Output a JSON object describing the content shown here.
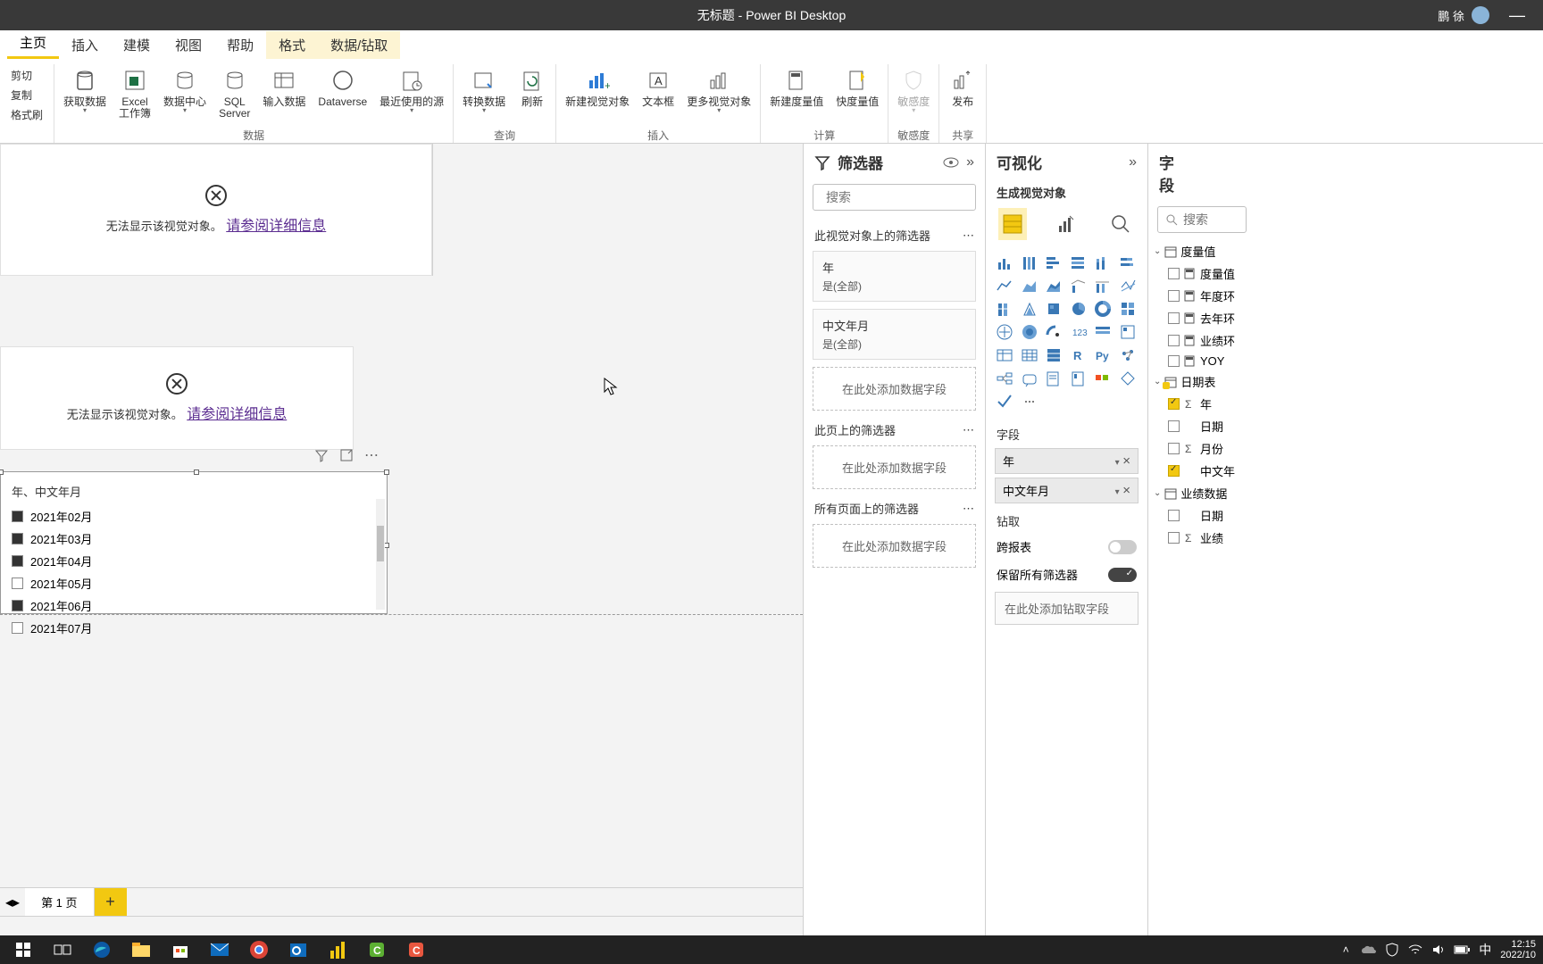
{
  "titlebar": {
    "title": "无标题 - Power BI Desktop",
    "user": "鹏 徐"
  },
  "menu": {
    "tabs": [
      "主页",
      "插入",
      "建模",
      "视图",
      "帮助",
      "格式",
      "数据/钻取"
    ],
    "active_index": 0,
    "highlight_from": 5
  },
  "ribbon": {
    "clipboard": {
      "cut": "剪切",
      "copy": "复制",
      "paint": "格式刷"
    },
    "data": {
      "label": "数据",
      "items": [
        "获取数据",
        "Excel\n工作簿",
        "数据中心",
        "SQL\nServer",
        "输入数据",
        "Dataverse",
        "最近使用的源"
      ]
    },
    "query": {
      "label": "查询",
      "items": [
        "转换数据",
        "刷新"
      ]
    },
    "insert": {
      "label": "插入",
      "items": [
        "新建视觉对象",
        "文本框",
        "更多视觉对象"
      ]
    },
    "calc": {
      "label": "计算",
      "items": [
        "新建度量值",
        "快度量值"
      ]
    },
    "sens": {
      "label": "敏感度",
      "items": [
        "敏感度"
      ]
    },
    "share": {
      "label": "共享",
      "items": [
        "发布"
      ]
    }
  },
  "canvas": {
    "visual_error": "无法显示该视觉对象。",
    "visual_link": "请参阅详细信息",
    "slicer_title": "年、中文年月",
    "slicer_items": [
      {
        "label": "2021年02月",
        "checked": true
      },
      {
        "label": "2021年03月",
        "checked": true
      },
      {
        "label": "2021年04月",
        "checked": true
      },
      {
        "label": "2021年05月",
        "checked": false
      },
      {
        "label": "2021年06月",
        "checked": true
      },
      {
        "label": "2021年07月",
        "checked": false
      }
    ]
  },
  "pagetabs": {
    "page1": "第 1 页"
  },
  "filters": {
    "title": "筛选器",
    "search_placeholder": "搜索",
    "on_visual": "此视觉对象上的筛选器",
    "cards": [
      {
        "name": "年",
        "value": "是(全部)"
      },
      {
        "name": "中文年月",
        "value": "是(全部)"
      }
    ],
    "add_field": "在此处添加数据字段",
    "on_page": "此页上的筛选器",
    "on_all": "所有页面上的筛选器"
  },
  "viz": {
    "title": "可视化",
    "subtitle": "生成视觉对象",
    "field_label": "字段",
    "wells": [
      "年",
      "中文年月"
    ],
    "drill_label": "钻取",
    "cross": "跨报表",
    "keep": "保留所有筛选器",
    "drill_drop": "在此处添加钻取字段"
  },
  "fields": {
    "title": "字段",
    "search_placeholder": "搜索",
    "tables": [
      {
        "name": "度量值",
        "rows": [
          {
            "name": "度量值",
            "checked": false,
            "icon": "calc"
          },
          {
            "name": "年度环",
            "checked": false,
            "icon": "calc"
          },
          {
            "name": "去年环",
            "checked": false,
            "icon": "calc"
          },
          {
            "name": "业绩环",
            "checked": false,
            "icon": "calc"
          },
          {
            "name": "YOY",
            "checked": false,
            "icon": "calc"
          }
        ]
      },
      {
        "name": "日期表",
        "calc": true,
        "rows": [
          {
            "name": "年",
            "checked": true,
            "icon": "sum"
          },
          {
            "name": "日期",
            "checked": false,
            "icon": ""
          },
          {
            "name": "月份",
            "checked": false,
            "icon": "sum"
          },
          {
            "name": "中文年",
            "checked": true,
            "icon": ""
          }
        ]
      },
      {
        "name": "业绩数据",
        "rows": [
          {
            "name": "日期",
            "checked": false,
            "icon": ""
          },
          {
            "name": "业绩",
            "checked": false,
            "icon": "sum"
          }
        ]
      }
    ]
  },
  "taskbar": {
    "ime": "中",
    "time": "12:15",
    "date": "2022/10"
  }
}
